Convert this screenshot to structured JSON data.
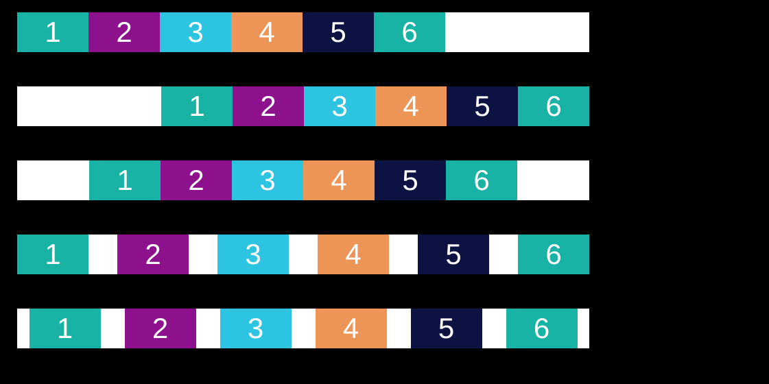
{
  "rows": [
    {
      "justify": "flex-start",
      "items": [
        {
          "label": "1",
          "color": "#19b3a6"
        },
        {
          "label": "2",
          "color": "#8d118c"
        },
        {
          "label": "3",
          "color": "#2cc4e0"
        },
        {
          "label": "4",
          "color": "#ed9457"
        },
        {
          "label": "5",
          "color": "#0c1241"
        },
        {
          "label": "6",
          "color": "#19b3a6"
        }
      ]
    },
    {
      "justify": "flex-end",
      "items": [
        {
          "label": "1",
          "color": "#19b3a6"
        },
        {
          "label": "2",
          "color": "#8d118c"
        },
        {
          "label": "3",
          "color": "#2cc4e0"
        },
        {
          "label": "4",
          "color": "#ed9457"
        },
        {
          "label": "5",
          "color": "#0c1241"
        },
        {
          "label": "6",
          "color": "#19b3a6"
        }
      ]
    },
    {
      "justify": "center",
      "items": [
        {
          "label": "1",
          "color": "#19b3a6"
        },
        {
          "label": "2",
          "color": "#8d118c"
        },
        {
          "label": "3",
          "color": "#2cc4e0"
        },
        {
          "label": "4",
          "color": "#ed9457"
        },
        {
          "label": "5",
          "color": "#0c1241"
        },
        {
          "label": "6",
          "color": "#19b3a6"
        }
      ]
    },
    {
      "justify": "space-between",
      "items": [
        {
          "label": "1",
          "color": "#19b3a6"
        },
        {
          "label": "2",
          "color": "#8d118c"
        },
        {
          "label": "3",
          "color": "#2cc4e0"
        },
        {
          "label": "4",
          "color": "#ed9457"
        },
        {
          "label": "5",
          "color": "#0c1241"
        },
        {
          "label": "6",
          "color": "#19b3a6"
        }
      ]
    },
    {
      "justify": "space-around",
      "items": [
        {
          "label": "1",
          "color": "#19b3a6"
        },
        {
          "label": "2",
          "color": "#8d118c"
        },
        {
          "label": "3",
          "color": "#2cc4e0"
        },
        {
          "label": "4",
          "color": "#ed9457"
        },
        {
          "label": "5",
          "color": "#0c1241"
        },
        {
          "label": "6",
          "color": "#19b3a6"
        }
      ]
    }
  ]
}
